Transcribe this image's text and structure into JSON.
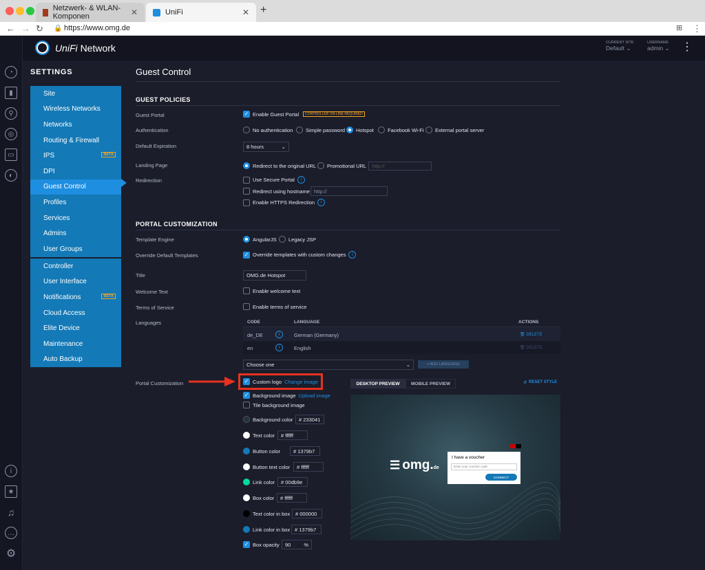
{
  "browser": {
    "tabs": [
      {
        "label": "Netzwerk- & WLAN-Komponen"
      },
      {
        "label": "UniFi"
      }
    ],
    "url": "https://www.omg.de"
  },
  "header": {
    "brand": "UniFi",
    "product": "Network",
    "site_label": "CURRENT SITE",
    "site_value": "Default",
    "user_label": "USERNAME",
    "user_value": "admin"
  },
  "settings": {
    "title": "SETTINGS",
    "group1": [
      "Site",
      "Wireless Networks",
      "Networks",
      "Routing & Firewall",
      "IPS",
      "DPI",
      "Guest Control",
      "Profiles",
      "Services",
      "Admins",
      "User Groups"
    ],
    "group2": [
      "Controller",
      "User Interface",
      "Notifications",
      "Cloud Access",
      "Elite Device",
      "Maintenance",
      "Auto Backup"
    ],
    "beta": "BETA"
  },
  "page": {
    "title": "Guest Control"
  },
  "policies": {
    "heading": "GUEST POLICIES",
    "guest_portal_label": "Guest Portal",
    "enable_guest_portal": "Enable Guest Portal",
    "controller_badge": "CONTROLLER ON-LINE REQUIRED",
    "auth_label": "Authentication",
    "auth_options": [
      "No authentication",
      "Simple password",
      "Hotspot",
      "Facebook Wi-Fi",
      "External portal server"
    ],
    "expiration_label": "Default Expiration",
    "expiration_value": "8 hours",
    "landing_label": "Landing Page",
    "landing_original": "Redirect to the original URL",
    "landing_promo": "Promotional URL",
    "promo_placeholder": "http://",
    "redirection_label": "Redirection",
    "secure_portal": "Use Secure Portal",
    "redirect_hostname": "Redirect using hostname",
    "hostname_placeholder": "http://",
    "https_redirect": "Enable HTTPS Redirection"
  },
  "portal": {
    "heading": "PORTAL CUSTOMIZATION",
    "engine_label": "Template Engine",
    "engine_angular": "AngularJS",
    "engine_legacy": "Legacy JSP",
    "override_label": "Override Default Templates",
    "override_text": "Override templates with custom changes",
    "title_label": "Title",
    "title_value": "OMG.de Hotspot",
    "welcome_label": "Welcome Text",
    "welcome_text": "Enable welcome text",
    "tos_label": "Terms of Service",
    "tos_text": "Enable terms of service",
    "languages_label": "Languages",
    "lang_cols": [
      "CODE",
      "LANGUAGE",
      "ACTIONS"
    ],
    "lang_rows": [
      {
        "code": "de_DE",
        "language": "German (Germany)",
        "action": "DELETE"
      },
      {
        "code": "en",
        "language": "English",
        "action": "DELETE"
      }
    ],
    "choose_one": "Choose one",
    "add_language": "+ ADD LANGUAGE",
    "custom_label": "Portal Customization",
    "custom_logo": "Custom logo",
    "change_image": "Change image",
    "bg_image": "Background image",
    "upload_image": "Upload image",
    "tile_bg": "Tile background image",
    "colors": [
      {
        "label": "Background color",
        "value": "233041",
        "swatch": "#233041"
      },
      {
        "label": "Text color",
        "value": "ffffff",
        "swatch": "#ffffff"
      },
      {
        "label": "Button color",
        "value": "1379b7",
        "swatch": "#1379b7"
      },
      {
        "label": "Button text color",
        "value": "ffffff",
        "swatch": "#ffffff"
      },
      {
        "label": "Link color",
        "value": "00db9e",
        "swatch": "#00db9e"
      },
      {
        "label": "Box color",
        "value": "ffffff",
        "swatch": "#ffffff"
      },
      {
        "label": "Text color in box",
        "value": "000000",
        "swatch": "#000000"
      },
      {
        "label": "Link color in box",
        "value": "1379b7",
        "swatch": "#1379b7"
      }
    ],
    "hash": "#",
    "box_opacity_label": "Box opacity",
    "box_opacity_value": "90",
    "percent": "%",
    "tab_desktop": "DESKTOP PREVIEW",
    "tab_mobile": "MOBILE PREVIEW",
    "reset": "RESET STYLE",
    "preview": {
      "logo": "omg.",
      "logo_suffix": "de",
      "voucher_title": "I have a voucher",
      "voucher_placeholder": "Enter your voucher code",
      "connect": "CONNECT"
    }
  },
  "accent": "#1e8ee0",
  "annotation_color": "#e8321e"
}
